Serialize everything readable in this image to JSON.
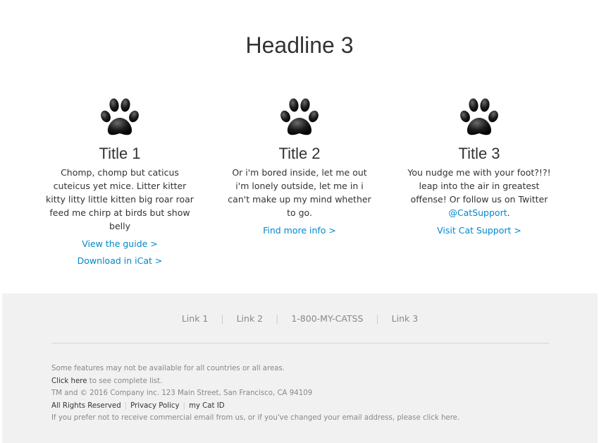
{
  "headline": "Headline 3",
  "columns": [
    {
      "icon": "paw-print-icon",
      "title": "Title 1",
      "text": "Chomp, chomp but caticus cuteicus yet mice. Litter kitter kitty litty little kitten big roar roar feed me chirp at birds but show belly",
      "links": [
        "View the guide >",
        "Download in iCat >"
      ]
    },
    {
      "icon": "paw-print-icon",
      "title": "Title 2",
      "text": "Or i'm bored inside, let me out i'm lonely outside, let me in i can't make up my mind whether to go.",
      "links": [
        "Find more info >"
      ]
    },
    {
      "icon": "paw-print-icon",
      "title": "Title 3",
      "text_before": "You nudge me with your foot?!?! leap into the air in greatest offense! Or follow us on Twitter ",
      "handle": "@CatSupport",
      "text_after": ".",
      "links": [
        "Visit Cat Support >"
      ]
    }
  ],
  "footer": {
    "links": [
      "Link 1",
      "Link 2",
      "1-800-MY-CATSS",
      "Link 3"
    ],
    "separator": "|",
    "legal": {
      "availability": "Some features may not be available for all countries or all areas.",
      "click_here": "Click here",
      "see_list": " to see complete list.",
      "copyright": "TM and © 2016 Company inc. 123 Main Street, San Francisco, CA 94109",
      "policy_links": [
        "All Rights Reserved",
        "Privacy Policy",
        "my Cat ID"
      ],
      "unsubscribe_before": "If you prefer not to receive commercial email from us, or if you've changed your email address, please ",
      "unsubscribe_link": "click here",
      "unsubscribe_after": "."
    }
  },
  "colors": {
    "link": "#0088cc",
    "text": "#333333",
    "footer_bg": "#f1f1f1",
    "muted": "#888888"
  }
}
